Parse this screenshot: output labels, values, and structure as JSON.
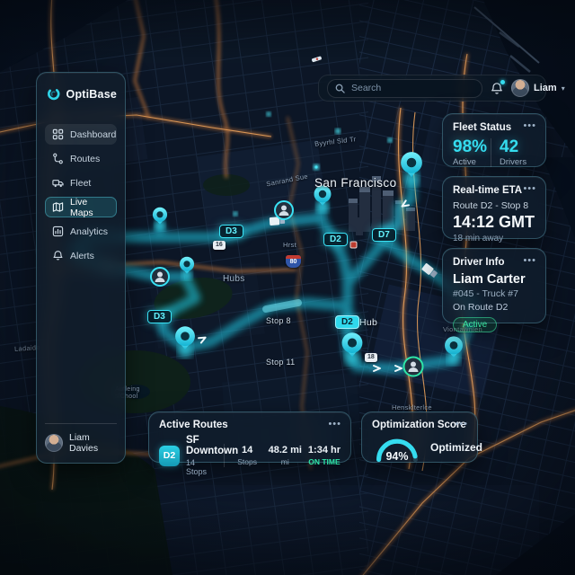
{
  "topbar": {
    "search_placeholder": "Search",
    "user_name": "Liam",
    "chevron": "▾"
  },
  "sidebar": {
    "brand": "OptiBase",
    "items": [
      {
        "label": "Dashboard"
      },
      {
        "label": "Routes"
      },
      {
        "label": "Fleet"
      },
      {
        "label": "Live Maps"
      },
      {
        "label": "Analytics"
      },
      {
        "label": "Alerts"
      }
    ],
    "active_item": "Live Maps",
    "user_name": "Liam Davies"
  },
  "panels": {
    "fleet_status": {
      "title": "Fleet Status",
      "menu": "•••",
      "stats": [
        {
          "value": "98%",
          "label": "Active"
        },
        {
          "value": "42",
          "label": "Drivers"
        }
      ]
    },
    "eta": {
      "title": "Real-time ETA",
      "menu": "•••",
      "route": "Route D2 - Stop 8",
      "time": "14:12 GMT",
      "away": "18 min away"
    },
    "driver": {
      "title": "Driver Info",
      "menu": "•••",
      "name": "Liam Carter",
      "vehicle": "#045 - Truck #7",
      "route": "On Route D2",
      "status": "Active"
    },
    "active_routes": {
      "title": "Active Routes",
      "menu": "•••",
      "route_badge": "D2",
      "route_name": "SF Downtown",
      "route_sub": "14 Stops",
      "stats": [
        {
          "value": "14",
          "label": "Stops"
        },
        {
          "value": "48.2 mi",
          "label": "mi"
        },
        {
          "value": "1:34 hr",
          "label": "ON TIME"
        }
      ]
    },
    "optimization": {
      "title": "Optimization Score",
      "menu": "•••",
      "score": "94%",
      "score_value": 94,
      "label": "Optimized"
    }
  },
  "map": {
    "city_label": "San Francisco",
    "labels": {
      "street1": "Byyrhl Sld Tr",
      "street2": "Sanrand Sue",
      "hrst": "Hrst",
      "hubs": "Hubs",
      "hub": "Hub",
      "stop8": "Stop 8",
      "stop11": "Stop 11",
      "viontawnlen": "Viontawnlen",
      "ladaide": "Ladaide",
      "aufleing_1": "Aufleing",
      "aufleing_2": "slChool",
      "hensk": "Hensklterlce"
    },
    "badges": {
      "d3": "D3",
      "d2": "D2",
      "d7": "D7"
    },
    "shields": {
      "s16": "16",
      "s80": "80",
      "s18": "18"
    }
  },
  "colors": {
    "accent": "#35dcef",
    "success": "#2ee6a8",
    "road_orange": "#d8813c"
  }
}
